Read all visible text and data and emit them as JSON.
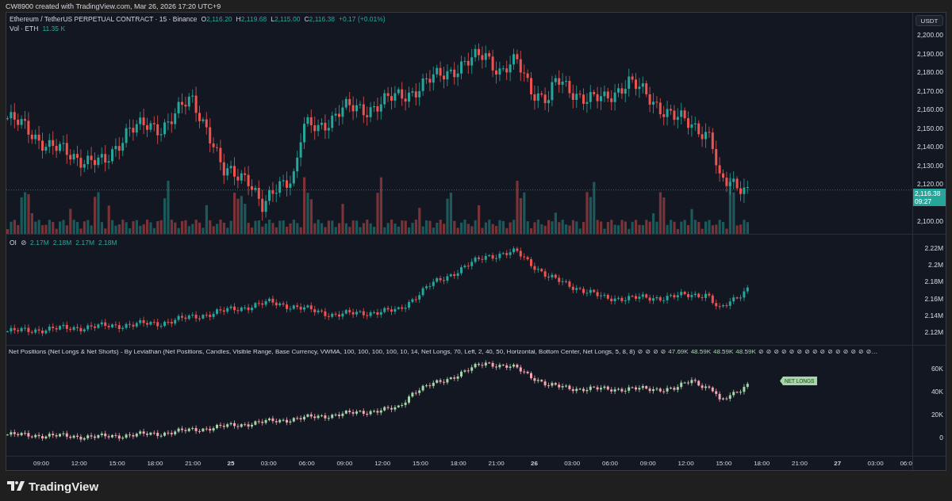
{
  "header": {
    "text": "CW8900 created with TradingView.com, Mar 26, 2026 17:20 UTC+9"
  },
  "price_pane": {
    "legend": {
      "symbol": "Ethereum / TetherUS PERPETUAL CONTRACT · 15 · Binance",
      "ohlc": [
        {
          "label": "O",
          "value": "2,116.20"
        },
        {
          "label": "H",
          "value": "2,119.68"
        },
        {
          "label": "L",
          "value": "2,115.00"
        },
        {
          "label": "C",
          "value": "2,116.38"
        }
      ],
      "change": "+0.17 (+0.01%)"
    },
    "volume_legend": {
      "label": "Vol · ETH",
      "value": "11.35 K"
    },
    "currency": "USDT",
    "axis_labels": [
      "2,200.00",
      "2,190.00",
      "2,180.00",
      "2,170.00",
      "2,160.00",
      "2,150.00",
      "2,140.00",
      "2,130.00",
      "2,120.00",
      "2,100.00"
    ],
    "last_price": {
      "value": "2,116.38",
      "countdown": "09:27"
    }
  },
  "oi_pane": {
    "label": "OI",
    "status": "⊘",
    "values": [
      "2.17M",
      "2.18M",
      "2.17M",
      "2.18M"
    ],
    "axis_labels": [
      "2.22M",
      "2.2M",
      "2.18M",
      "2.16M",
      "2.14M",
      "2.12M"
    ]
  },
  "net_pane": {
    "legend": "Net Positions (Net Longs & Net Shorts) - By Leviathan (Net Positions, Candles, Visible Range, Base Currency, VWMA, 100, 100, 100, 100, 10, 14, Net Longs, 70, Left, 2, 40, 50, Horizontal, Bottom Center, Net Longs, 5, 8, 8)",
    "values": [
      {
        "kind": "na",
        "text": "⊘"
      },
      {
        "kind": "na",
        "text": "⊘"
      },
      {
        "kind": "na",
        "text": "⊘"
      },
      {
        "kind": "na",
        "text": "⊘"
      },
      {
        "kind": "value",
        "text": "47.69K"
      },
      {
        "kind": "value",
        "text": "48.59K"
      },
      {
        "kind": "value",
        "text": "48.59K"
      },
      {
        "kind": "value",
        "text": "48.59K"
      },
      {
        "kind": "na",
        "text": "⊘"
      },
      {
        "kind": "na",
        "text": "⊘"
      },
      {
        "kind": "na",
        "text": "⊘"
      },
      {
        "kind": "na",
        "text": "⊘"
      },
      {
        "kind": "na",
        "text": "⊘"
      },
      {
        "kind": "na",
        "text": "⊘"
      },
      {
        "kind": "na",
        "text": "⊘"
      },
      {
        "kind": "na",
        "text": "⊘"
      },
      {
        "kind": "na",
        "text": "⊘"
      },
      {
        "kind": "na",
        "text": "⊘"
      },
      {
        "kind": "na",
        "text": "⊘"
      },
      {
        "kind": "na",
        "text": "⊘"
      },
      {
        "kind": "na",
        "text": "⊘"
      },
      {
        "kind": "na",
        "text": "⊘"
      },
      {
        "kind": "na",
        "text": "⊘…"
      }
    ],
    "tag": "NET LONGS",
    "axis_labels": [
      "60K",
      "40K",
      "20K",
      "0"
    ]
  },
  "time_axis": [
    {
      "kind": "time",
      "text": "09:00"
    },
    {
      "kind": "time",
      "text": "12:00"
    },
    {
      "kind": "time",
      "text": "15:00"
    },
    {
      "kind": "time",
      "text": "18:00"
    },
    {
      "kind": "time",
      "text": "21:00"
    },
    {
      "kind": "day",
      "text": "25"
    },
    {
      "kind": "time",
      "text": "03:00"
    },
    {
      "kind": "time",
      "text": "06:00"
    },
    {
      "kind": "time",
      "text": "09:00"
    },
    {
      "kind": "time",
      "text": "12:00"
    },
    {
      "kind": "time",
      "text": "15:00"
    },
    {
      "kind": "time",
      "text": "18:00"
    },
    {
      "kind": "time",
      "text": "21:00"
    },
    {
      "kind": "day",
      "text": "26"
    },
    {
      "kind": "time",
      "text": "03:00"
    },
    {
      "kind": "time",
      "text": "06:00"
    },
    {
      "kind": "time",
      "text": "09:00"
    },
    {
      "kind": "time",
      "text": "12:00"
    },
    {
      "kind": "time",
      "text": "15:00"
    },
    {
      "kind": "time",
      "text": "18:00"
    },
    {
      "kind": "time",
      "text": "21:00"
    },
    {
      "kind": "day",
      "text": "27"
    },
    {
      "kind": "time",
      "text": "03:00"
    },
    {
      "kind": "time",
      "text": "06:0"
    }
  ],
  "footer": {
    "brand": "TradingView"
  }
}
